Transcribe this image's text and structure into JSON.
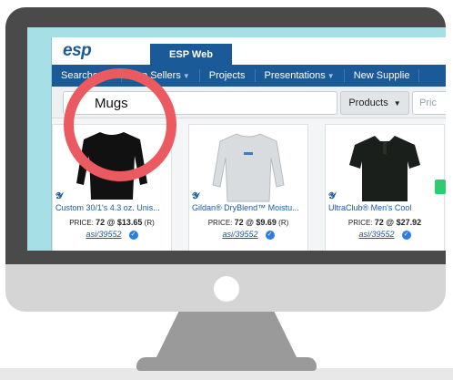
{
  "header": {
    "logo_text": "esp",
    "active_tab": "ESP Web"
  },
  "nav": {
    "items": [
      {
        "label": "Searches",
        "has_caret": true
      },
      {
        "label": "Top Sellers",
        "has_caret": true
      },
      {
        "label": "Projects",
        "has_caret": false
      },
      {
        "label": "Presentations",
        "has_caret": true
      },
      {
        "label": "New Supplie",
        "has_caret": false
      }
    ]
  },
  "search": {
    "value": "Mugs",
    "category": "Products",
    "price_placeholder": "Pric"
  },
  "results": [
    {
      "title": "Custom 30/1's 4.3 oz. Unis...",
      "price_prefix": "PRICE:",
      "price_value": "72 @ $13.65",
      "price_suffix": "(R)",
      "asi": "asi/39552",
      "shirt_color": "#111111"
    },
    {
      "title": "Gildan® DryBlend™ Moistu...",
      "price_prefix": "PRICE:",
      "price_value": "72 @ $9.69",
      "price_suffix": "(R)",
      "asi": "asi/39552",
      "shirt_color": "#d9dcdf"
    },
    {
      "title": "UltraClub® Men's Cool",
      "price_prefix": "PRICE:",
      "price_value": "72 @ $27.92",
      "price_suffix": "",
      "asi": "asi/39552",
      "shirt_color": "#1b1f1b"
    }
  ],
  "colors": {
    "brand_blue": "#1a5a99",
    "highlight_ring": "#ec5a61",
    "screen_background": "#a7dfe6",
    "verified_blue": "#2a7de1"
  },
  "icons": {
    "search": "search-icon",
    "supplier": "supplier-logo-icon",
    "verified": "verified-check-icon"
  }
}
